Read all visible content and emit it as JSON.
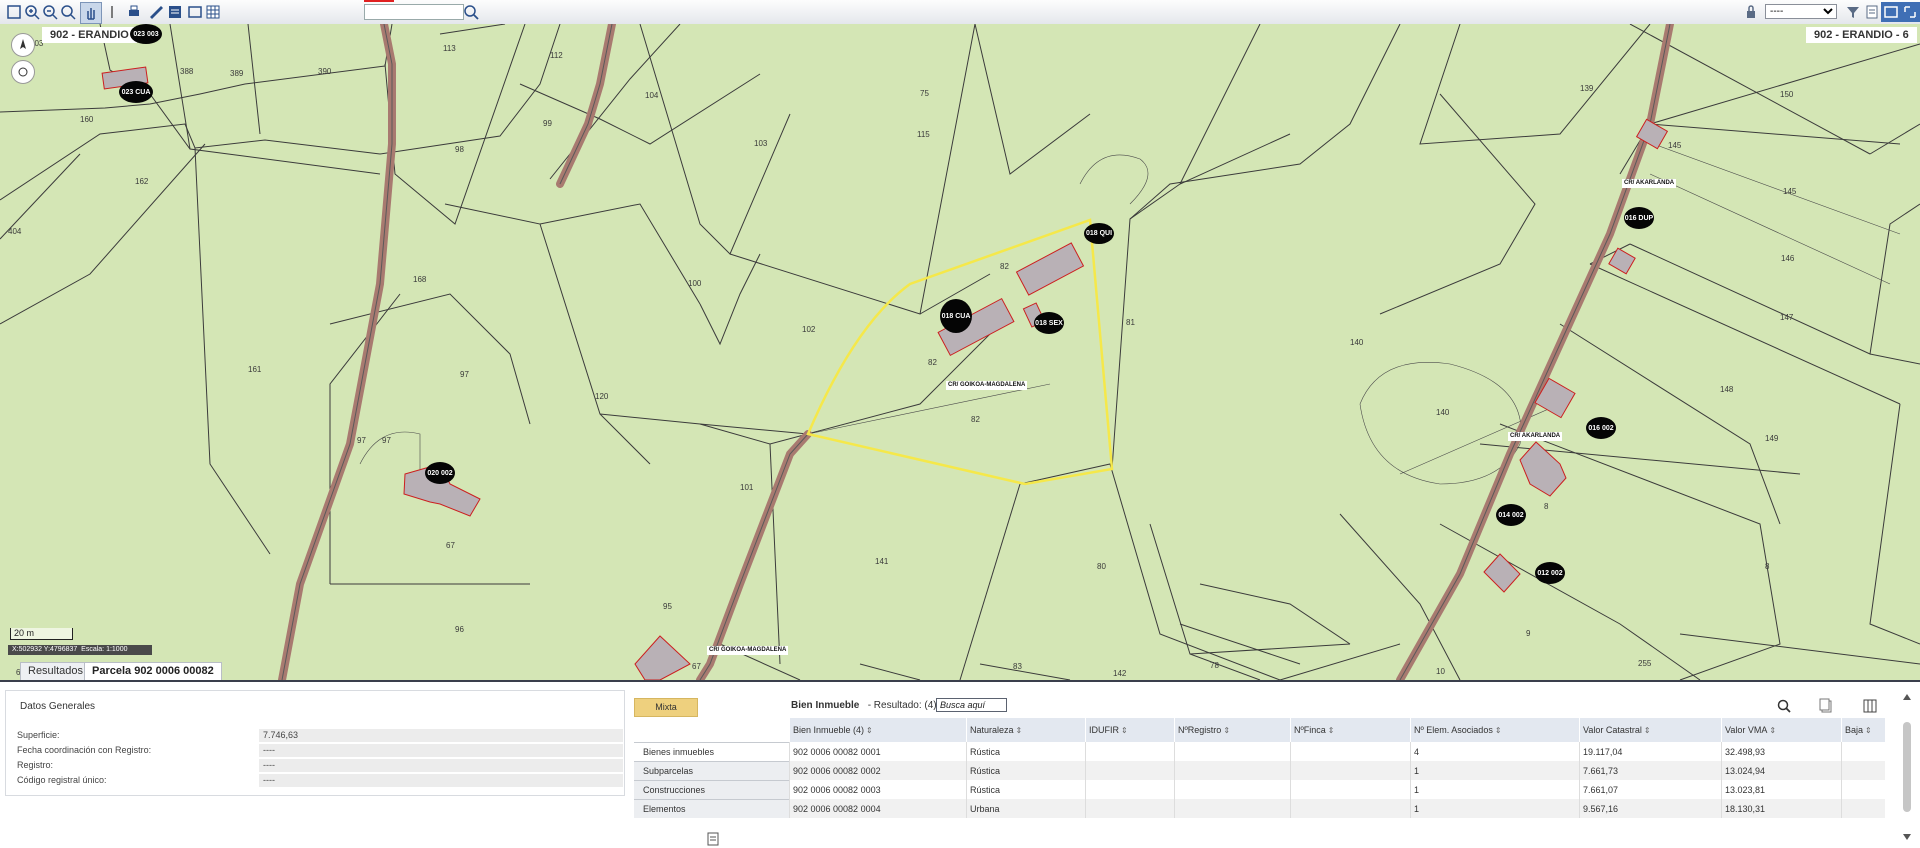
{
  "toolbar": {
    "search_placeholder": "",
    "scale_value": "----",
    "icons": [
      "zoom-extent-icon",
      "zoom-in-icon",
      "zoom-out-icon",
      "zoom-previous-icon",
      "select-icon",
      "pan-icon",
      "print-icon",
      "measure-icon",
      "layers-icon",
      "grid-icon",
      "info-icon",
      "search-icon"
    ]
  },
  "map": {
    "municipality_left": "902 - ERANDIO",
    "municipality_right": "902 - ERANDIO - 6",
    "scale_text": "20 m",
    "coordinates": "X:502932 Y:4796837",
    "scale_ratio": "Escala: 1:1000",
    "selected_parcel_highlight": "#f5e84a",
    "parcel_fill": "#d4e6b5",
    "road_color": "#a87a70",
    "building_fill": "#b9b1b6",
    "building_outline": "#cc1f1f",
    "street_labels": [
      "CR/ GOIKOA-MAGDALENA",
      "CR/ AKARLANDA",
      "CR/ AKARLANDA",
      "CR/ GOIKOA-MAGDALENA"
    ],
    "parcel_numbers": [
      "403",
      "113",
      "112",
      "104",
      "75",
      "139",
      "150",
      "388",
      "389",
      "390",
      "99",
      "115",
      "103",
      "145",
      "160",
      "98",
      "162",
      "145",
      "404",
      "168",
      "100",
      "82",
      "81",
      "146",
      "102",
      "82",
      "147",
      "161",
      "97",
      "120",
      "140",
      "148",
      "82",
      "149",
      "97",
      "97",
      "97",
      "101",
      "140",
      "67",
      "96",
      "8",
      "95",
      "141",
      "80",
      "9",
      "255",
      "142",
      "83",
      "78",
      "10",
      "66",
      "67",
      "162",
      "75"
    ],
    "badges": [
      "023 003",
      "023 CUA",
      "018 QUI",
      "018 CUA",
      "018 SEX",
      "020 002",
      "016 DUP",
      "016 002",
      "014 002",
      "012 002"
    ]
  },
  "tabs": {
    "results": "Resultados",
    "parcel": "Parcela 902 0006 00082"
  },
  "datos_generales": {
    "title": "Datos Generales",
    "rows": [
      {
        "key": "Superficie:",
        "value": "7.746,63"
      },
      {
        "key": "Fecha coordinación con Registro:",
        "value": "----"
      },
      {
        "key": "Registro:",
        "value": "----"
      },
      {
        "key": "Código registral único:",
        "value": "----"
      }
    ]
  },
  "mixta_label": "Mixta",
  "side_menu": [
    "Bienes inmuebles",
    "Subparcelas",
    "Construcciones",
    "Elementos"
  ],
  "bien_inmueble": {
    "title": "Bien Inmueble",
    "result_label": "- Resultado: (4)",
    "search_placeholder": "Busca aquí",
    "headers": [
      "Bien Inmueble (4)",
      "Naturaleza",
      "IDUFIR",
      "NºRegistro",
      "NºFinca",
      "Nº Elem. Asociados",
      "Valor Catastral",
      "Valor VMA",
      "Baja"
    ],
    "rows": [
      [
        "902 0006 00082 0001",
        "Rústica",
        "",
        "",
        "",
        "4",
        "19.117,04",
        "32.498,93",
        ""
      ],
      [
        "902 0006 00082 0002",
        "Rústica",
        "",
        "",
        "",
        "1",
        "7.661,73",
        "13.024,94",
        ""
      ],
      [
        "902 0006 00082 0003",
        "Rústica",
        "",
        "",
        "",
        "1",
        "7.661,07",
        "13.023,81",
        ""
      ],
      [
        "902 0006 00082 0004",
        "Urbana",
        "",
        "",
        "",
        "1",
        "9.567,16",
        "18.130,31",
        ""
      ]
    ]
  }
}
